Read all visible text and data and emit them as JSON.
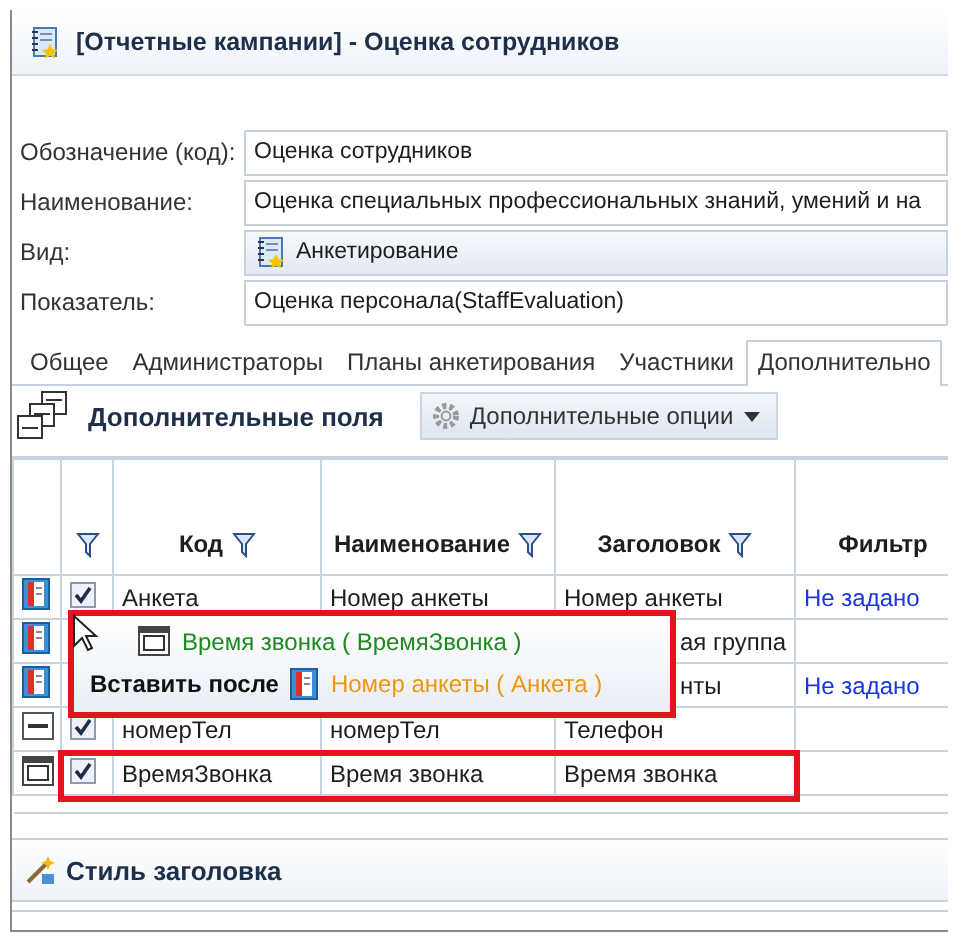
{
  "window": {
    "title": "[Отчетные кампании] - Оценка сотрудников"
  },
  "form": {
    "fields": [
      {
        "label": "Обозначение (код):",
        "value": "Оценка сотрудников",
        "kind": "text"
      },
      {
        "label": "Наименование:",
        "value": "Оценка специальных профессиональных знаний, умений и на",
        "kind": "text"
      },
      {
        "label": "Вид:",
        "value": "Анкетирование",
        "kind": "combo"
      },
      {
        "label": "Показатель:",
        "value": "Оценка персонала(StaffEvaluation)",
        "kind": "text"
      }
    ]
  },
  "tabs": [
    {
      "label": "Общее",
      "selected": false
    },
    {
      "label": "Администраторы",
      "selected": false
    },
    {
      "label": "Планы анкетирования",
      "selected": false
    },
    {
      "label": "Участники",
      "selected": false
    },
    {
      "label": "Дополнительно",
      "selected": true
    }
  ],
  "section": {
    "title": "Дополнительные поля",
    "options_button": "Дополнительные опции"
  },
  "table": {
    "columns": [
      {
        "filter": false
      },
      {
        "filter": true
      },
      {
        "label": "Код",
        "filter": true
      },
      {
        "label": "Наименование",
        "filter": true
      },
      {
        "label": "Заголовок",
        "filter": true
      },
      {
        "label": "Фильтр",
        "filter": false
      }
    ],
    "rows": [
      {
        "kind": "list",
        "checked": true,
        "highlighted": false,
        "code": "Анкета",
        "name": "Номер анкеты",
        "caption": "Номер анкеты",
        "filter": "Не задано"
      },
      {
        "kind": "list",
        "highlighted": false,
        "caption": "ая группа"
      },
      {
        "kind": "list",
        "highlighted": false,
        "caption": "нты",
        "filter": "Не задано"
      },
      {
        "kind": "text",
        "checked": true,
        "highlighted": false,
        "code": "номерТел",
        "name": "номерТел",
        "caption": "Телефон"
      },
      {
        "kind": "date",
        "checked": true,
        "highlighted": true,
        "code": "ВремяЗвонка",
        "name": "Время звонка",
        "caption": "Время звонка"
      }
    ]
  },
  "drag_tooltip": {
    "highlighted": true,
    "item": {
      "kind": "date",
      "text": "Время звонка ( ВремяЗвонка )"
    },
    "action": "Вставить после",
    "target": {
      "kind": "list",
      "text": "Номер анкеты ( Анкета )"
    }
  },
  "style_section": {
    "title": "Стиль заголовка"
  }
}
